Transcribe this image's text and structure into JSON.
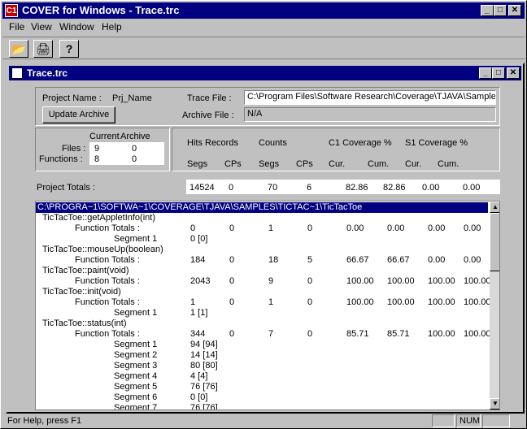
{
  "app": {
    "title": "COVER for Windows - Trace.trc",
    "icon_text": "C1",
    "buttons": {
      "minimize": "_",
      "maximize": "□",
      "close": "✕"
    }
  },
  "menu": [
    "File",
    "View",
    "Window",
    "Help"
  ],
  "toolbar": [
    {
      "name": "open-icon",
      "glyph": "📂"
    },
    {
      "name": "print-icon",
      "glyph": "🖨"
    },
    {
      "name": "help-icon",
      "glyph": "?"
    }
  ],
  "child": {
    "title": "Trace.trc"
  },
  "project": {
    "name_label": "Project Name :",
    "name_value": "Prj_Name",
    "update_label": "Update Archive",
    "trace_label": "Trace File :",
    "trace_value": "C:\\Program Files\\Software Research\\Coverage\\TJAVA\\Sample",
    "archive_label": "Archive File :",
    "archive_value": "N/A"
  },
  "files_panel": {
    "current_hdr": "Current",
    "archive_hdr": "Archive",
    "files_label": "Files :",
    "files_current": "9",
    "files_archive": "0",
    "functions_label": "Functions :",
    "functions_current": "8",
    "functions_archive": "0"
  },
  "stats_header": {
    "hits_records": "Hits Records",
    "counts": "Counts",
    "c1": "C1 Coverage %",
    "s1": "S1 Coverage %",
    "segs1": "Segs",
    "cps1": "CPs",
    "segs2": "Segs",
    "cps2": "CPs",
    "cur1": "Cur.",
    "cum1": "Cum.",
    "cur2": "Cur.",
    "cum2": "Cum."
  },
  "project_totals": {
    "label": "Project Totals :",
    "values": [
      "14524",
      "0",
      "70",
      "6",
      "82.86",
      "82.86",
      "0.00",
      "0.00"
    ]
  },
  "list": {
    "path": "C:\\PROGRA~1\\SOFTWA~1\\COVERAGE\\TJAVA\\SAMPLES\\TICTAC~1\\TicTacToe",
    "rows": [
      {
        "kind": "fn",
        "label": "TicTacToe::getAppletInfo(int)"
      },
      {
        "kind": "tot",
        "label": "Function Totals :",
        "v": [
          "0",
          "0",
          "1",
          "0",
          "0.00",
          "0.00",
          "0.00",
          "0.00"
        ]
      },
      {
        "kind": "seg",
        "label": "Segment 1",
        "v": [
          "0  [0]"
        ]
      },
      {
        "kind": "fn",
        "label": "TicTacToe::mouseUp(boolean)"
      },
      {
        "kind": "tot",
        "label": "Function Totals :",
        "v": [
          "184",
          "0",
          "18",
          "5",
          "66.67",
          "66.67",
          "0.00",
          "0.00"
        ]
      },
      {
        "kind": "fn",
        "label": "TicTacToe::paint(void)"
      },
      {
        "kind": "tot",
        "label": "Function Totals :",
        "v": [
          "2043",
          "0",
          "9",
          "0",
          "100.00",
          "100.00",
          "100.00",
          "100.00"
        ]
      },
      {
        "kind": "fn",
        "label": "TicTacToe::init(void)"
      },
      {
        "kind": "tot",
        "label": "Function Totals :",
        "v": [
          "1",
          "0",
          "1",
          "0",
          "100.00",
          "100.00",
          "100.00",
          "100.00"
        ]
      },
      {
        "kind": "seg",
        "label": "Segment 1",
        "v": [
          "1  [1]"
        ]
      },
      {
        "kind": "fn",
        "label": "TicTacToe::status(int)"
      },
      {
        "kind": "tot",
        "label": "Function Totals :",
        "v": [
          "344",
          "0",
          "7",
          "0",
          "85.71",
          "85.71",
          "100.00",
          "100.00"
        ]
      },
      {
        "kind": "seg",
        "label": "Segment 1",
        "v": [
          "94  [94]"
        ]
      },
      {
        "kind": "seg",
        "label": "Segment 2",
        "v": [
          "14  [14]"
        ]
      },
      {
        "kind": "seg",
        "label": "Segment 3",
        "v": [
          "80  [80]"
        ]
      },
      {
        "kind": "seg",
        "label": "Segment 4",
        "v": [
          "4  [4]"
        ]
      },
      {
        "kind": "seg",
        "label": "Segment 5",
        "v": [
          "76  [76]"
        ]
      },
      {
        "kind": "seg",
        "label": "Segment 6",
        "v": [
          "0  [0]"
        ]
      },
      {
        "kind": "seg",
        "label": "Segment 7",
        "v": [
          "76  [76]"
        ]
      }
    ]
  },
  "statusbar": {
    "help": "For Help, press F1",
    "num": "NUM"
  }
}
